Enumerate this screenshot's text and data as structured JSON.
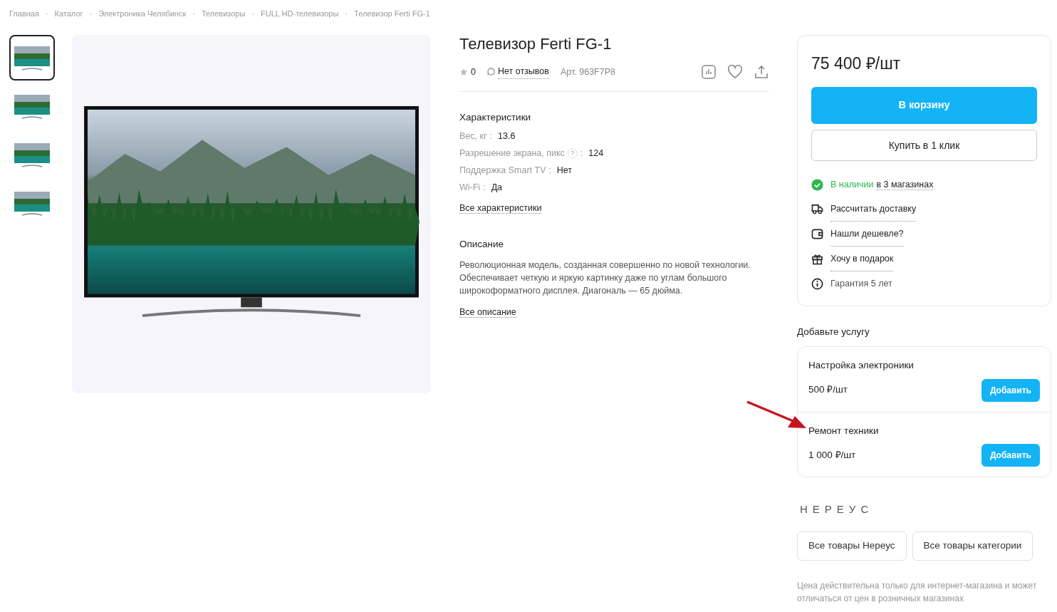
{
  "breadcrumbs": {
    "separator": "·",
    "items": [
      "Главная",
      "Каталог",
      "Электроника Челябинск",
      "Телевизоры",
      "FULL HD-телевизоры",
      "Телевизор Ferti FG-1"
    ]
  },
  "gallery": {
    "thumbnails": [
      {
        "selected": true
      },
      {
        "selected": false
      },
      {
        "selected": false
      },
      {
        "selected": false
      }
    ]
  },
  "product": {
    "title": "Телевизор Ferti FG-1",
    "rating": "0",
    "reviews": "Нет отзывов",
    "article": "Арт. 963F7P8",
    "specs_title": "Характеристики",
    "specs": [
      {
        "label": "Вес, кг",
        "colon": ":",
        "value": "13.6",
        "hint": false
      },
      {
        "label": "Разрешение экрана, пикс",
        "colon": ":",
        "value": "124",
        "hint": true,
        "hint_mark": "?"
      },
      {
        "label": "Поддержка Smart TV",
        "colon": ":",
        "value": "Нет",
        "hint": false
      },
      {
        "label": "Wi-Fi",
        "colon": ":",
        "value": "Да",
        "hint": false
      }
    ],
    "specs_link": "Все характеристики",
    "description_title": "Описание",
    "description": "Революционная модель, созданная совершенно по новой технологии. Обеспечивает четкую и яркую картинку даже по углам большого широкоформатного дисплея. Диагональ — 65 дюйма.",
    "description_link": "Все описание"
  },
  "buy_box": {
    "price": "75 400 ₽/шт",
    "cart_button": "В корзину",
    "one_click_button": "Купить в 1 клик",
    "features": [
      {
        "kind": "stock",
        "status": "В наличии",
        "text": "в 3 магазинах"
      },
      {
        "kind": "delivery",
        "text": "Рассчитать доставку"
      },
      {
        "kind": "cheaper",
        "text": "Нашли дешевле?"
      },
      {
        "kind": "gift",
        "text": "Хочу в подарок"
      },
      {
        "kind": "warranty",
        "text": "Гарантия 5 лет"
      }
    ]
  },
  "services": {
    "title": "Добавьте услугу",
    "items": [
      {
        "name": "Настройка электроники",
        "price": "500 ₽/шт",
        "button": "Добавить"
      },
      {
        "name": "Ремонт техники",
        "price": "1 000 ₽/шт",
        "button": "Добавить"
      }
    ]
  },
  "brand": {
    "logo": "НЕРЕУС",
    "buttons": [
      "Все товары Нереус",
      "Все товары категории"
    ]
  },
  "note": "Цена действительна только для интернет-магазина и может отличаться от цен в розничных магазинах"
}
